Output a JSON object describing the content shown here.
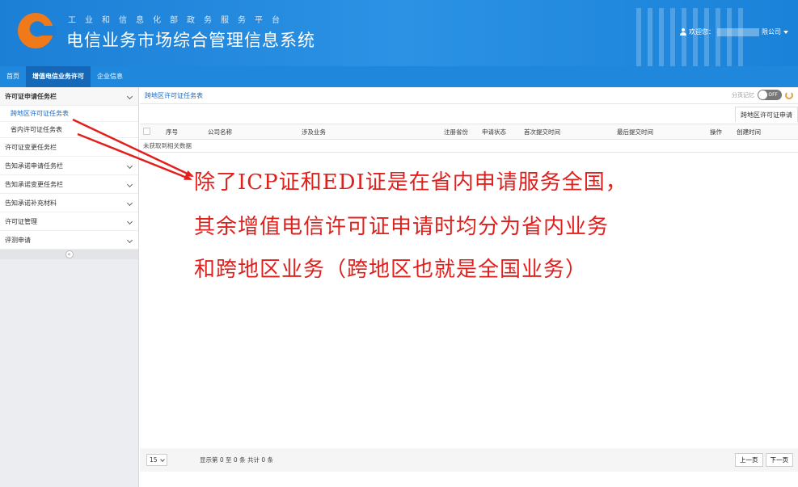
{
  "header": {
    "subtitle": "工业和信息化部政务服务平台",
    "title": "电信业务市场综合管理信息系统",
    "user_label": "欢迎您：",
    "company_suffix": "限公司"
  },
  "nav": {
    "tabs": [
      {
        "label": "首页"
      },
      {
        "label": "增值电信业务许可"
      },
      {
        "label": "企业信息"
      }
    ]
  },
  "sidebar": {
    "group_title": "许可证申请任务栏",
    "sub_items": [
      {
        "label": "跨地区许可证任务表"
      },
      {
        "label": "省内许可证任务表"
      }
    ],
    "items": [
      {
        "label": "许可证变更任务栏"
      },
      {
        "label": "告知承诺申请任务栏"
      },
      {
        "label": "告知承诺变更任务栏"
      },
      {
        "label": "告知承诺补充材料"
      },
      {
        "label": "许可证管理"
      },
      {
        "label": "评测申请"
      }
    ]
  },
  "content": {
    "breadcrumb": "跨地区许可证任务表",
    "page_memory_label": "分页记忆",
    "switch_label": "OFF",
    "subtab": "跨地区许可证申请",
    "columns": [
      "序号",
      "公司名称",
      "涉及业务",
      "注册省份",
      "申请状态",
      "首次提交时间",
      "最后提交时间",
      "操作",
      "创建时间"
    ],
    "empty_text": "未获取到相关数据"
  },
  "pager": {
    "page_size": "15",
    "info": "显示第 0 至 0 条 共计 0 条",
    "prev": "上一页",
    "next": "下一页"
  },
  "annotation": {
    "line1": "除了ICP证和EDI证是在省内申请服务全国，",
    "line2": "其余增值电信许可证申请时均分为省内业务",
    "line3": "和跨地区业务（跨地区也就是全国业务）",
    "color": "#e0201d"
  }
}
